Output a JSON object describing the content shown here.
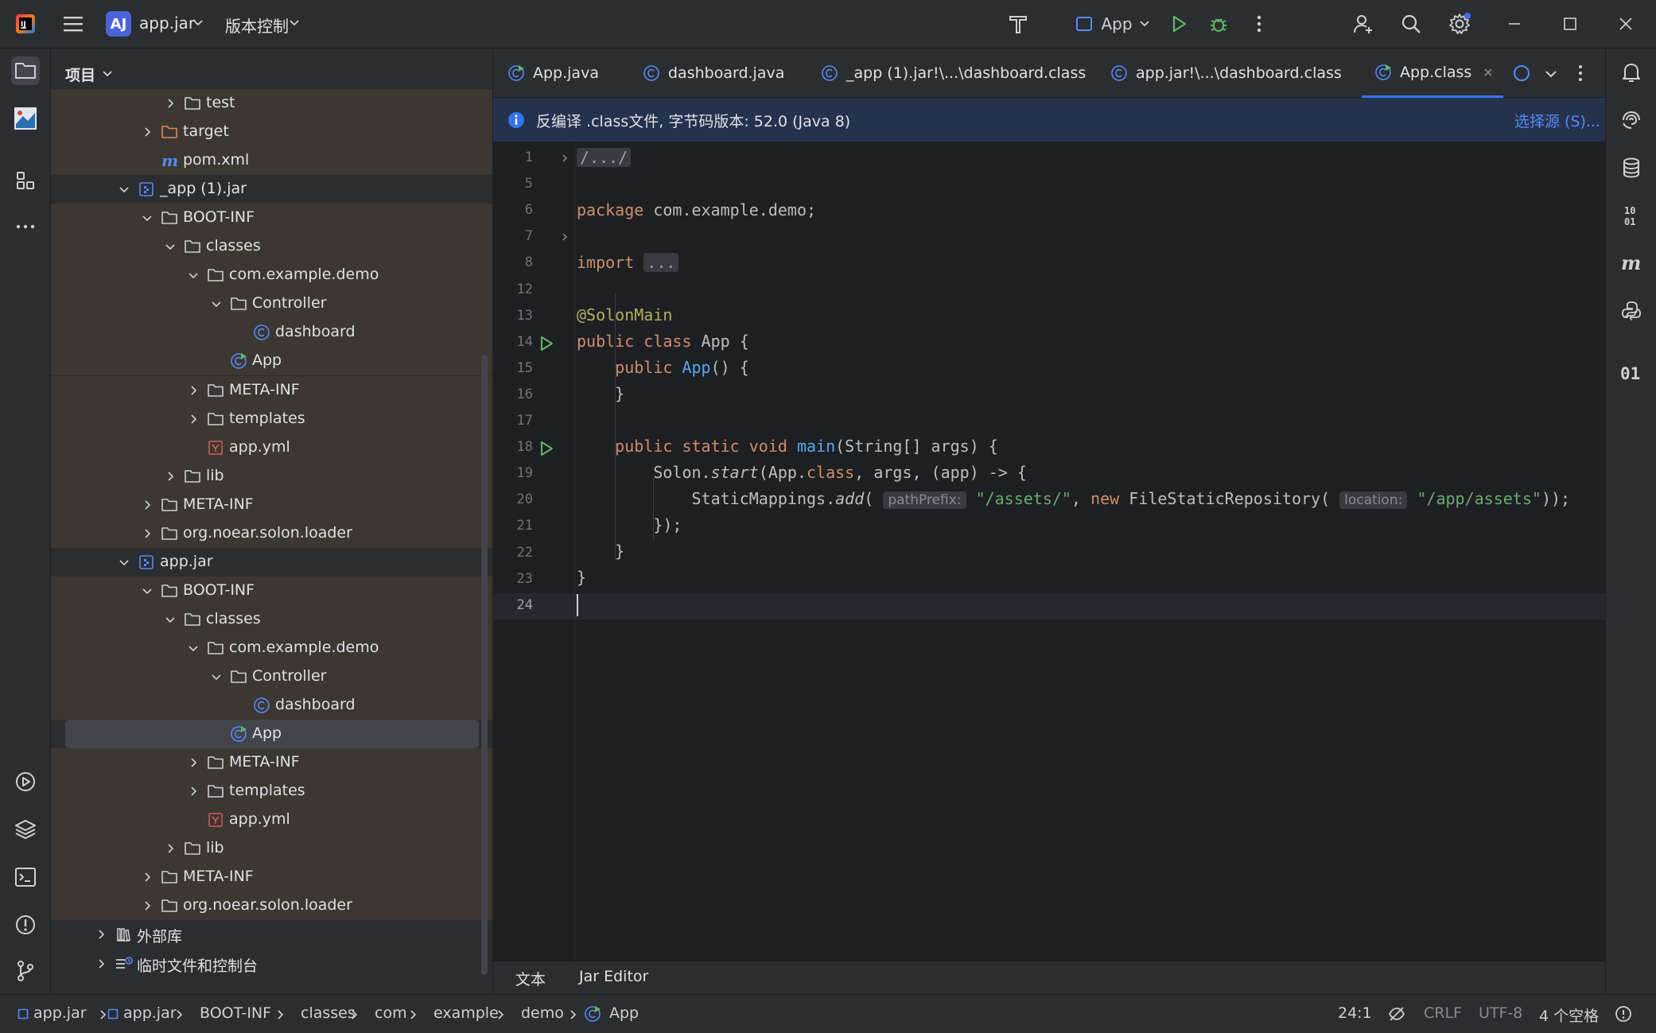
{
  "titlebar": {
    "project_badge": "AJ",
    "project_name": "app.jar",
    "vcs_menu": "版本控制",
    "run_config": "App"
  },
  "project_panel": {
    "title": "项目",
    "tree": [
      {
        "label": "test",
        "depth": 4,
        "icon": "folder-icon",
        "expanded": false
      },
      {
        "label": "target",
        "depth": 3,
        "icon": "folder-excluded-icon",
        "expanded": false
      },
      {
        "label": "pom.xml",
        "depth": 3,
        "icon": "maven-icon"
      },
      {
        "label": "_app (1).jar",
        "depth": 2,
        "icon": "jar-icon",
        "expanded": true
      },
      {
        "label": "BOOT-INF",
        "depth": 3,
        "icon": "folder-icon",
        "expanded": true
      },
      {
        "label": "classes",
        "depth": 4,
        "icon": "folder-icon",
        "expanded": true
      },
      {
        "label": "com.example.demo",
        "depth": 5,
        "icon": "folder-icon",
        "expanded": true
      },
      {
        "label": "Controller",
        "depth": 6,
        "icon": "folder-icon",
        "expanded": true
      },
      {
        "label": "dashboard",
        "depth": 7,
        "icon": "class-icon"
      },
      {
        "label": "App",
        "depth": 6,
        "icon": "class-run-icon"
      },
      {
        "label": "META-INF",
        "depth": 5,
        "icon": "folder-icon",
        "expanded": false
      },
      {
        "label": "templates",
        "depth": 5,
        "icon": "folder-icon",
        "expanded": false
      },
      {
        "label": "app.yml",
        "depth": 5,
        "icon": "yaml-icon"
      },
      {
        "label": "lib",
        "depth": 4,
        "icon": "folder-icon",
        "expanded": false
      },
      {
        "label": "META-INF",
        "depth": 3,
        "icon": "folder-icon",
        "expanded": false
      },
      {
        "label": "org.noear.solon.loader",
        "depth": 3,
        "icon": "folder-icon",
        "expanded": false
      },
      {
        "label": "app.jar",
        "depth": 2,
        "icon": "jar-icon",
        "expanded": true
      },
      {
        "label": "BOOT-INF",
        "depth": 3,
        "icon": "folder-icon",
        "expanded": true
      },
      {
        "label": "classes",
        "depth": 4,
        "icon": "folder-icon",
        "expanded": true
      },
      {
        "label": "com.example.demo",
        "depth": 5,
        "icon": "folder-icon",
        "expanded": true
      },
      {
        "label": "Controller",
        "depth": 6,
        "icon": "folder-icon",
        "expanded": true
      },
      {
        "label": "dashboard",
        "depth": 7,
        "icon": "class-icon"
      },
      {
        "label": "App",
        "depth": 6,
        "icon": "class-run-icon",
        "selected": true
      },
      {
        "label": "META-INF",
        "depth": 5,
        "icon": "folder-icon",
        "expanded": false
      },
      {
        "label": "templates",
        "depth": 5,
        "icon": "folder-icon",
        "expanded": false
      },
      {
        "label": "app.yml",
        "depth": 5,
        "icon": "yaml-icon"
      },
      {
        "label": "lib",
        "depth": 4,
        "icon": "folder-icon",
        "expanded": false
      },
      {
        "label": "META-INF",
        "depth": 3,
        "icon": "folder-icon",
        "expanded": false
      },
      {
        "label": "org.noear.solon.loader",
        "depth": 3,
        "icon": "folder-icon",
        "expanded": false
      },
      {
        "label": "外部库",
        "depth": 1,
        "icon": "library-icon",
        "expanded": false
      },
      {
        "label": "临时文件和控制台",
        "depth": 1,
        "icon": "scratch-icon",
        "expanded": false
      }
    ]
  },
  "tabs": [
    {
      "label": "App.java",
      "icon": "class-run-icon"
    },
    {
      "label": "dashboard.java",
      "icon": "class-icon"
    },
    {
      "label": "_app (1).jar!\\...\\dashboard.class",
      "icon": "class-icon"
    },
    {
      "label": "app.jar!\\...\\dashboard.class",
      "icon": "class-icon"
    },
    {
      "label": "App.class",
      "icon": "class-run-icon",
      "active": true
    }
  ],
  "banner": {
    "message": "反编译 .class文件, 字节码版本: 52.0 (Java 8)",
    "action": "选择源 (S)..."
  },
  "editor": {
    "line_numbers": [
      "1",
      "5",
      "6",
      "7",
      "8",
      "12",
      "13",
      "14",
      "15",
      "16",
      "17",
      "18",
      "19",
      "20",
      "21",
      "22",
      "23",
      "24"
    ],
    "code": {
      "l1": "/.../",
      "l6_kw": "package",
      "l6_rest": " com.example.demo;",
      "l8_kw": "import",
      "l8_fold": "...",
      "l13": "@SolonMain",
      "l14_kw": "public class",
      "l14_rest": " App {",
      "l15_kw": "public",
      "l15_fn": "App",
      "l15_rest": "() {",
      "l16": "}",
      "l18_kw": "public static void",
      "l18_fn": "main",
      "l18_rest": "(String[] args) {",
      "l19_a": "Solon.",
      "l19_fn": "start",
      "l19_b": "(App.",
      "l19_kw": "class",
      "l19_c": ", args, (app) -> {",
      "l20_a": "StaticMappings.",
      "l20_fn": "add",
      "l20_b": "(",
      "l20_hint1": "pathPrefix:",
      "l20_s1": "\"/assets/\"",
      "l20_c": ", ",
      "l20_kw": "new",
      "l20_d": " FileStaticRepository(",
      "l20_hint2": "location:",
      "l20_s2": "\"/app/assets\"",
      "l20_e": "));",
      "l21": "});",
      "l22": "}",
      "l23": "}"
    }
  },
  "bottom_tabs": {
    "text": "文本",
    "jar_editor": "Jar Editor"
  },
  "statusbar": {
    "breadcrumbs": [
      "app.jar",
      "app.jar",
      "BOOT-INF",
      "classes",
      "com",
      "example",
      "demo",
      "App"
    ],
    "position": "24:1",
    "line_ending": "CRLF",
    "encoding": "UTF-8",
    "indent": "4 个空格"
  }
}
